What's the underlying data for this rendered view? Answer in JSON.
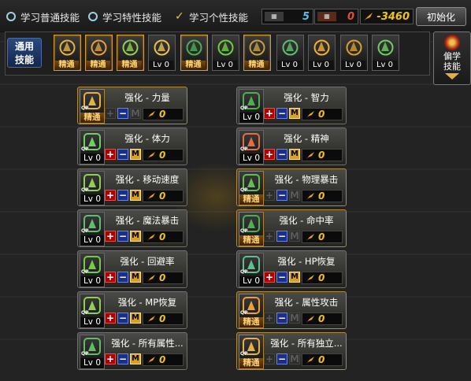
{
  "tabs": {
    "normal_label": "学习普通技能",
    "special_label": "学习特性技能",
    "personal_label": "学习个性技能"
  },
  "stats": {
    "sp_icon": "sp-icon",
    "sp_value": "5",
    "tp_icon": "tp-icon",
    "tp_value": "0",
    "qp_icon": "feather-icon",
    "qp_value": "-3460"
  },
  "init_button": "初始化",
  "shared_bar": {
    "label_line1": "通用",
    "label_line2": "技能",
    "icons": [
      {
        "name": "skill-icon-power",
        "level": "精通",
        "mastered": true
      },
      {
        "name": "skill-icon-stamina",
        "level": "精通",
        "mastered": true
      },
      {
        "name": "skill-icon-speed",
        "level": "精通",
        "mastered": true
      },
      {
        "name": "skill-icon-wings",
        "level": "Lv 0",
        "mastered": false
      },
      {
        "name": "skill-icon-target",
        "level": "精通",
        "mastered": true
      },
      {
        "name": "skill-icon-crosshair",
        "level": "Lv 0",
        "mastered": false
      },
      {
        "name": "skill-icon-dodge",
        "level": "精通",
        "mastered": true
      },
      {
        "name": "skill-icon-heal",
        "level": "Lv 0",
        "mastered": false
      },
      {
        "name": "skill-icon-eye",
        "level": "Lv 0",
        "mastered": false
      },
      {
        "name": "skill-icon-armor",
        "level": "Lv 0",
        "mastered": false
      },
      {
        "name": "skill-icon-spirit",
        "level": "Lv 0",
        "mastered": false
      }
    ]
  },
  "right_panel": {
    "line1": "偏学",
    "line2": "技能"
  },
  "skill_cards": [
    {
      "name": "强化 - 力量",
      "level": "精通",
      "mastered": true,
      "points": "0"
    },
    {
      "name": "强化 - 智力",
      "level": "Lv 0",
      "mastered": false,
      "points": "0"
    },
    {
      "name": "强化 - 体力",
      "level": "Lv 0",
      "mastered": false,
      "points": "0"
    },
    {
      "name": "强化 - 精神",
      "level": "Lv 0",
      "mastered": false,
      "points": "0"
    },
    {
      "name": "强化 - 移动速度",
      "level": "Lv 0",
      "mastered": false,
      "points": "0"
    },
    {
      "name": "强化 - 物理暴击",
      "level": "精通",
      "mastered": true,
      "points": "0"
    },
    {
      "name": "强化 - 魔法暴击",
      "level": "Lv 0",
      "mastered": false,
      "points": "0"
    },
    {
      "name": "强化 - 命中率",
      "level": "精通",
      "mastered": true,
      "points": "0"
    },
    {
      "name": "强化 - 回避率",
      "level": "Lv 0",
      "mastered": false,
      "points": "0"
    },
    {
      "name": "强化 - HP恢复",
      "level": "Lv 0",
      "mastered": false,
      "points": "0"
    },
    {
      "name": "强化 - MP恢复",
      "level": "Lv 0",
      "mastered": false,
      "points": "0"
    },
    {
      "name": "强化 - 属性攻击",
      "level": "精通",
      "mastered": true,
      "points": "0"
    },
    {
      "name": "强化 - 所有属性...",
      "level": "Lv 0",
      "mastered": false,
      "points": "0"
    },
    {
      "name": "强化 - 所有独立...",
      "level": "精通",
      "mastered": true,
      "points": "0"
    }
  ],
  "button_labels": {
    "plus": "+",
    "minus": "−",
    "max": "M"
  }
}
